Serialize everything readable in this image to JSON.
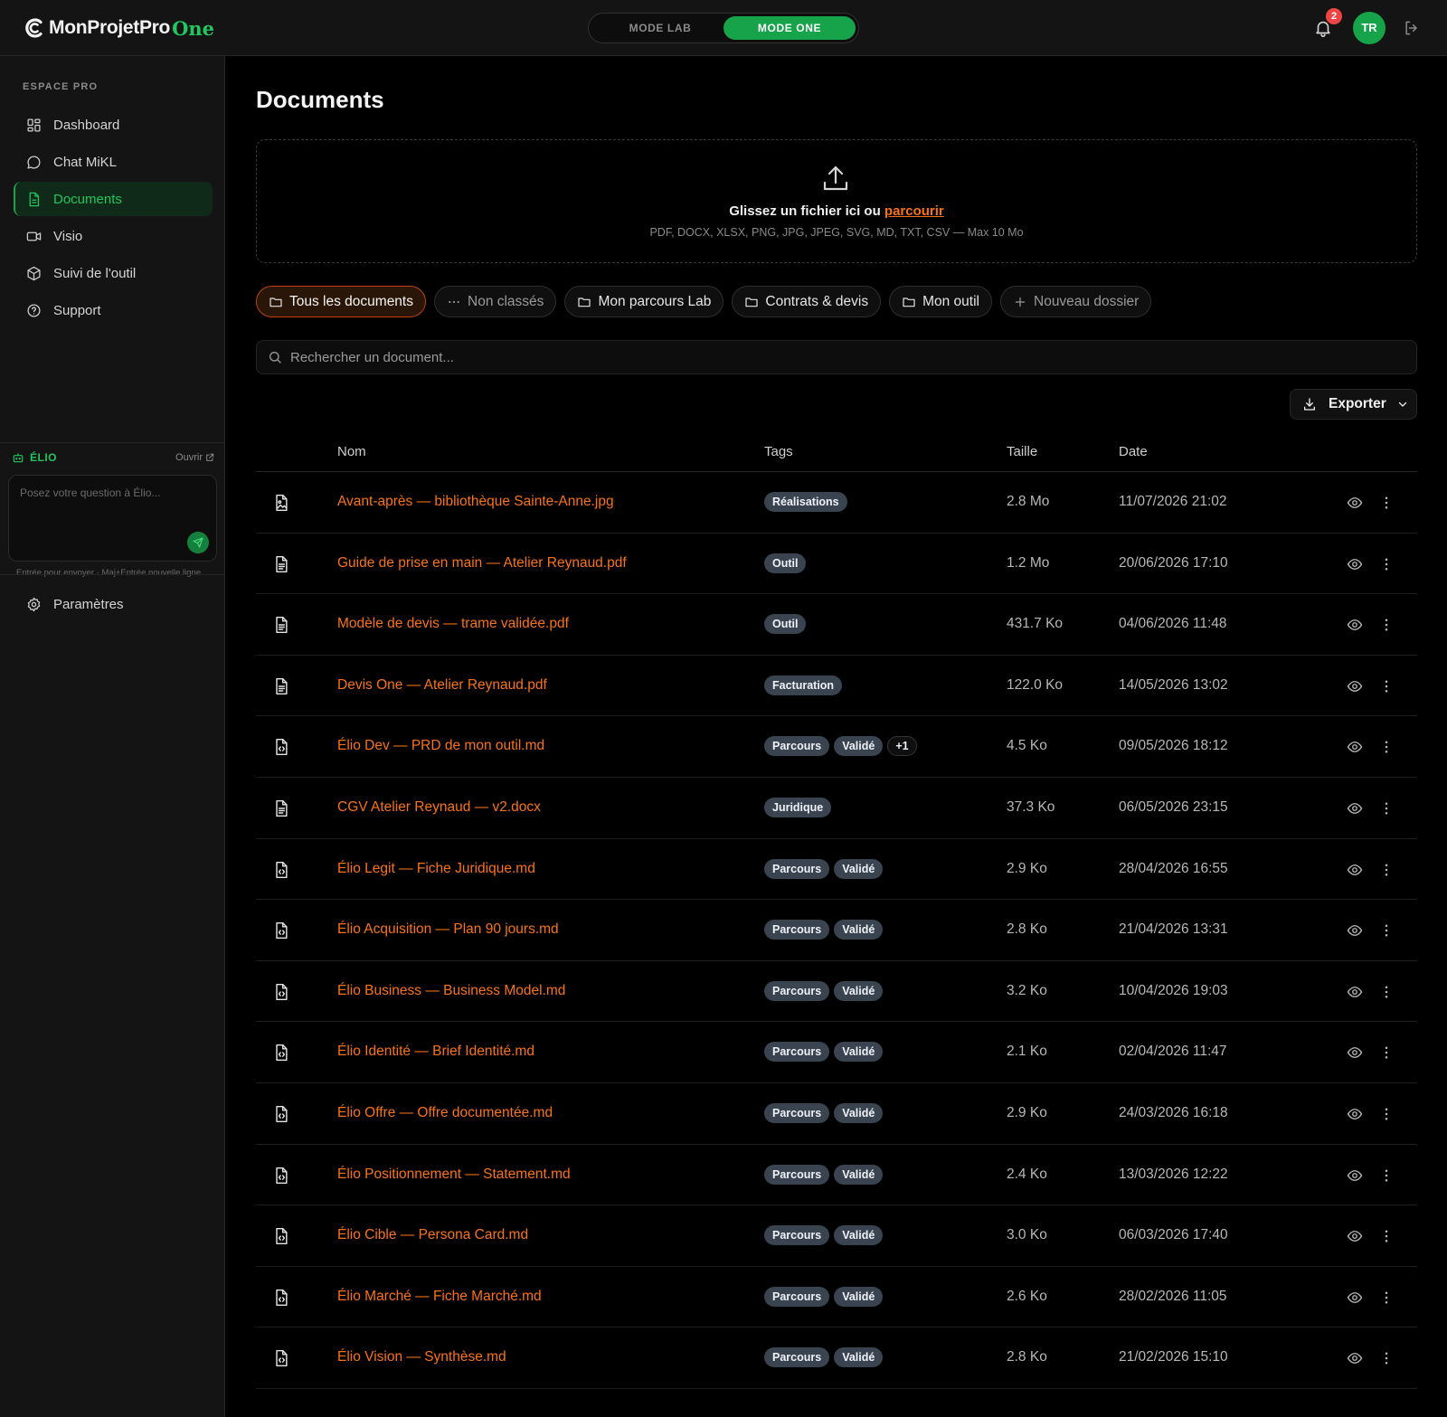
{
  "app": {
    "logo_text": "MonProjetPro",
    "logo_accent": "One",
    "mode_lab": "MODE LAB",
    "mode_one": "MODE ONE",
    "notifications_count": "2",
    "avatar_initials": "TR",
    "accent_color": "#22c55e",
    "link_color": "#f97316"
  },
  "sidebar": {
    "section_label": "ESPACE PRO",
    "items": [
      {
        "label": "Dashboard",
        "icon": "grid-icon"
      },
      {
        "label": "Chat MiKL",
        "icon": "chat-bubble-icon"
      },
      {
        "label": "Documents",
        "icon": "document-icon",
        "active": true
      },
      {
        "label": "Visio",
        "icon": "video-camera-icon"
      },
      {
        "label": "Suivi de l'outil",
        "icon": "cube-icon"
      },
      {
        "label": "Support",
        "icon": "help-circle-icon"
      }
    ],
    "elio": {
      "title": "ÉLIO",
      "open_label": "Ouvrir",
      "placeholder": "Posez votre question à Élio...",
      "hint": "Entrée pour envoyer · Maj+Entrée nouvelle ligne"
    },
    "settings_label": "Paramètres"
  },
  "main": {
    "title": "Documents",
    "dropzone": {
      "text": "Glissez un fichier ici ou",
      "link": "parcourir",
      "formats": "PDF, DOCX, XLSX, PNG, JPG, JPEG, SVG, MD, TXT, CSV — Max 10 Mo"
    },
    "folders": [
      {
        "label": "Tous les documents",
        "icon": "folder-icon",
        "active": true
      },
      {
        "label": "Non classés",
        "icon": "ellipsis-icon"
      },
      {
        "label": "Mon parcours Lab",
        "icon": "folder-icon"
      },
      {
        "label": "Contrats & devis",
        "icon": "folder-icon"
      },
      {
        "label": "Mon outil",
        "icon": "folder-icon"
      },
      {
        "label": "Nouveau dossier",
        "icon": "plus-icon"
      }
    ],
    "search_placeholder": "Rechercher un document...",
    "export_label": "Exporter",
    "table": {
      "columns": {
        "name": "Nom",
        "tags": "Tags",
        "size": "Taille",
        "date": "Date"
      },
      "rows": [
        {
          "name": "Avant-après — bibliothèque Sainte-Anne.jpg",
          "file_icon": "image-file-icon",
          "tags": [
            "Réalisations"
          ],
          "size": "2.8 Mo",
          "date": "11/07/2026 21:02"
        },
        {
          "name": "Guide de prise en main — Atelier Reynaud.pdf",
          "file_icon": "text-file-icon",
          "tags": [
            "Outil"
          ],
          "size": "1.2 Mo",
          "date": "20/06/2026 17:10"
        },
        {
          "name": "Modèle de devis — trame validée.pdf",
          "file_icon": "text-file-icon",
          "tags": [
            "Outil"
          ],
          "size": "431.7 Ko",
          "date": "04/06/2026 11:48"
        },
        {
          "name": "Devis One — Atelier Reynaud.pdf",
          "file_icon": "text-file-icon",
          "tags": [
            "Facturation"
          ],
          "size": "122.0 Ko",
          "date": "14/05/2026 13:02"
        },
        {
          "name": "Élio Dev — PRD de mon outil.md",
          "file_icon": "code-file-icon",
          "tags": [
            "Parcours",
            "Validé"
          ],
          "extra_tags": "+1",
          "size": "4.5 Ko",
          "date": "09/05/2026 18:12"
        },
        {
          "name": "CGV Atelier Reynaud — v2.docx",
          "file_icon": "text-file-icon",
          "tags": [
            "Juridique"
          ],
          "size": "37.3 Ko",
          "date": "06/05/2026 23:15"
        },
        {
          "name": "Élio Legit — Fiche Juridique.md",
          "file_icon": "code-file-icon",
          "tags": [
            "Parcours",
            "Validé"
          ],
          "size": "2.9 Ko",
          "date": "28/04/2026 16:55"
        },
        {
          "name": "Élio Acquisition — Plan 90 jours.md",
          "file_icon": "code-file-icon",
          "tags": [
            "Parcours",
            "Validé"
          ],
          "size": "2.8 Ko",
          "date": "21/04/2026 13:31"
        },
        {
          "name": "Élio Business — Business Model.md",
          "file_icon": "code-file-icon",
          "tags": [
            "Parcours",
            "Validé"
          ],
          "size": "3.2 Ko",
          "date": "10/04/2026 19:03"
        },
        {
          "name": "Élio Identité — Brief Identité.md",
          "file_icon": "code-file-icon",
          "tags": [
            "Parcours",
            "Validé"
          ],
          "size": "2.1 Ko",
          "date": "02/04/2026 11:47"
        },
        {
          "name": "Élio Offre — Offre documentée.md",
          "file_icon": "code-file-icon",
          "tags": [
            "Parcours",
            "Validé"
          ],
          "size": "2.9 Ko",
          "date": "24/03/2026 16:18"
        },
        {
          "name": "Élio Positionnement — Statement.md",
          "file_icon": "code-file-icon",
          "tags": [
            "Parcours",
            "Validé"
          ],
          "size": "2.4 Ko",
          "date": "13/03/2026 12:22"
        },
        {
          "name": "Élio Cible — Persona Card.md",
          "file_icon": "code-file-icon",
          "tags": [
            "Parcours",
            "Validé"
          ],
          "size": "3.0 Ko",
          "date": "06/03/2026 17:40"
        },
        {
          "name": "Élio Marché — Fiche Marché.md",
          "file_icon": "code-file-icon",
          "tags": [
            "Parcours",
            "Validé"
          ],
          "size": "2.6 Ko",
          "date": "28/02/2026 11:05"
        },
        {
          "name": "Élio Vision — Synthèse.md",
          "file_icon": "code-file-icon",
          "tags": [
            "Parcours",
            "Validé"
          ],
          "size": "2.8 Ko",
          "date": "21/02/2026 15:10"
        }
      ]
    }
  }
}
